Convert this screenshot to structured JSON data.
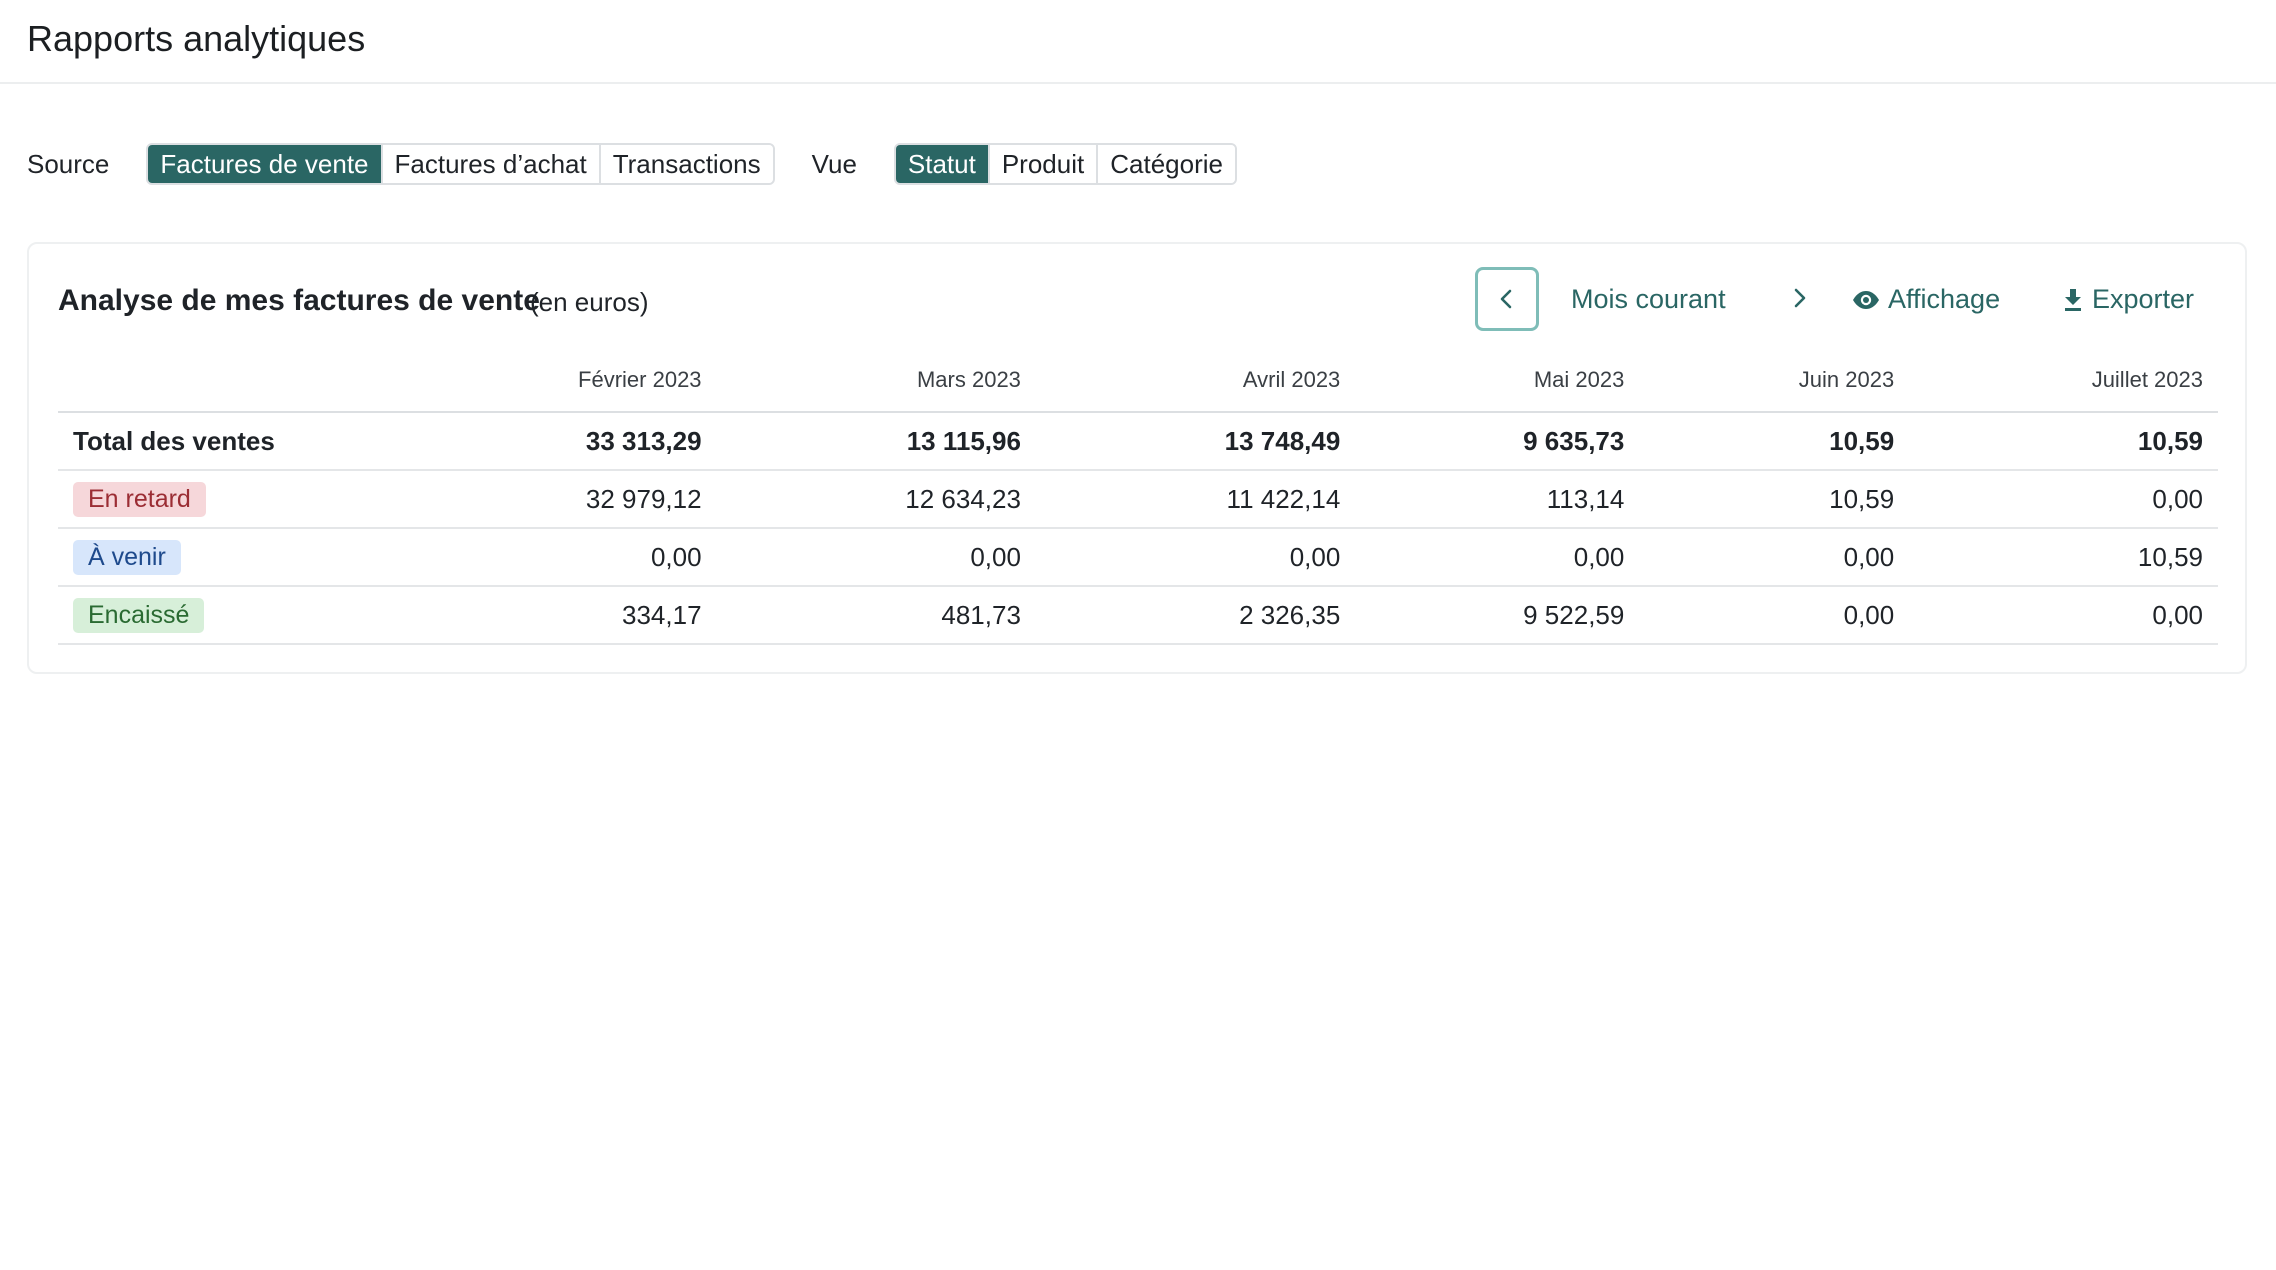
{
  "header": {
    "title": "Rapports analytiques"
  },
  "filters": {
    "source_label": "Source",
    "source_options": [
      "Factures de vente",
      "Factures d’achat",
      "Transactions"
    ],
    "source_selected": "Factures de vente",
    "view_label": "Vue",
    "view_options": [
      "Statut",
      "Produit",
      "Catégorie"
    ],
    "view_selected": "Statut"
  },
  "card": {
    "title": "Analyse de mes factures de vente",
    "subtitle": "(en euros)",
    "period_label": "Mois courant",
    "view_action": "Affichage",
    "export_action": "Exporter"
  },
  "table": {
    "columns": [
      "Février 2023",
      "Mars 2023",
      "Avril 2023",
      "Mai 2023",
      "Juin 2023",
      "Juillet 2023"
    ],
    "rows": [
      {
        "label": "Total des ventes",
        "values": [
          "33 313,29",
          "13 115,96",
          "13 748,49",
          "9 635,73",
          "10,59",
          "10,59"
        ]
      },
      {
        "label": "En retard",
        "values": [
          "32 979,12",
          "12 634,23",
          "11 422,14",
          "113,14",
          "10,59",
          "0,00"
        ]
      },
      {
        "label": "À venir",
        "values": [
          "0,00",
          "0,00",
          "0,00",
          "0,00",
          "0,00",
          "10,59"
        ]
      },
      {
        "label": "Encaissé",
        "values": [
          "334,17",
          "481,73",
          "2 326,35",
          "9 522,59",
          "0,00",
          "0,00"
        ]
      }
    ]
  },
  "colors": {
    "accent": "#2a6664",
    "late_badge": "#f6d7da",
    "upcoming_badge": "#d7e6fb",
    "paid_badge": "#d7efd9"
  }
}
